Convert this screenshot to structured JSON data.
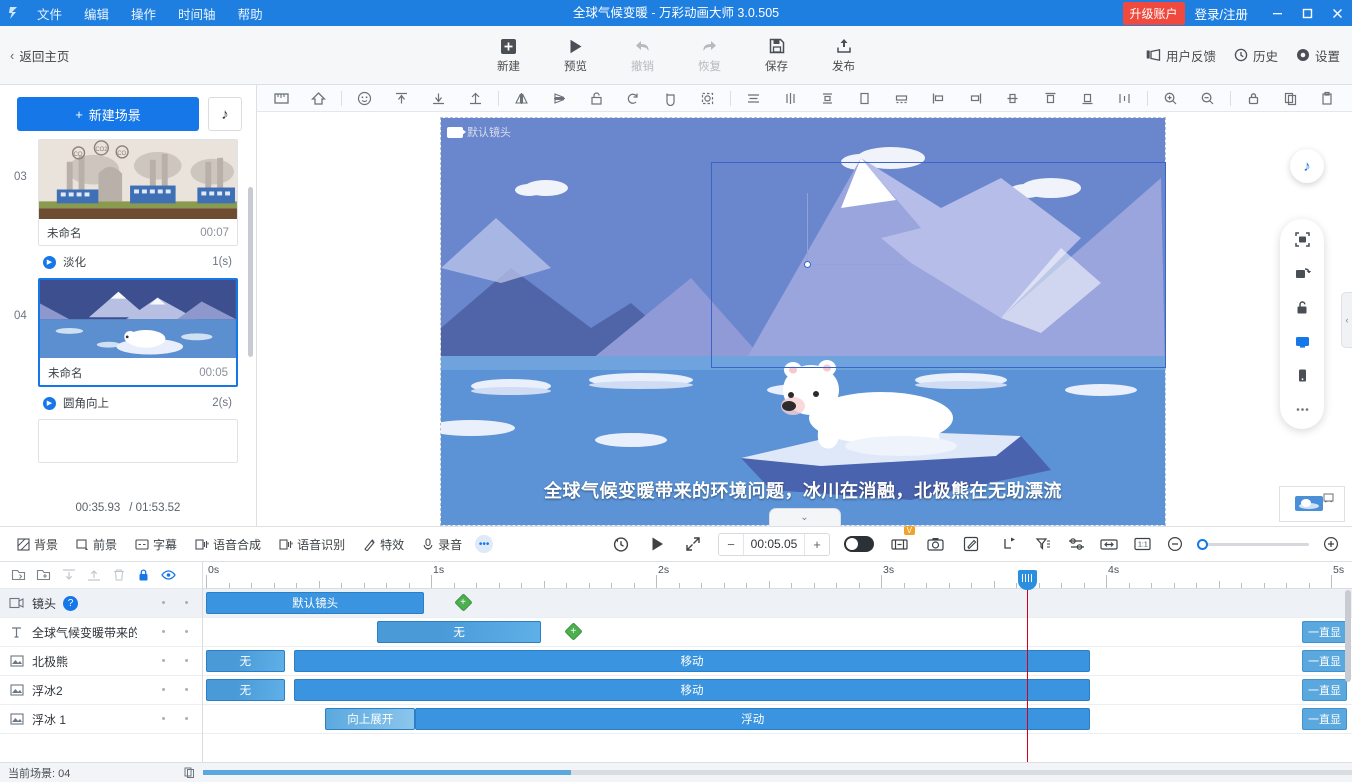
{
  "titlebar": {
    "logo_icon": "app-logo-icon",
    "menus": [
      "文件",
      "编辑",
      "操作",
      "时间轴",
      "帮助"
    ],
    "title": "全球气候变暖 - 万彩动画大师 3.0.505",
    "upgrade_label": "升级账户",
    "login_label": "登录/注册",
    "minimize_icon": "minimize-icon",
    "maximize_icon": "maximize-icon",
    "close_icon": "close-icon",
    "accent": "#1f7fe0",
    "upgrade_color": "#f0493e"
  },
  "toptoolbar": {
    "back_label": "返回主页",
    "buttons": [
      {
        "label": "新建",
        "icon": "new-icon",
        "disabled": false
      },
      {
        "label": "预览",
        "icon": "play-icon",
        "disabled": false
      },
      {
        "label": "撤销",
        "icon": "undo-icon",
        "disabled": true
      },
      {
        "label": "恢复",
        "icon": "redo-icon",
        "disabled": true
      },
      {
        "label": "保存",
        "icon": "save-icon",
        "disabled": false
      },
      {
        "label": "发布",
        "icon": "publish-icon",
        "disabled": false
      }
    ],
    "right": [
      {
        "label": "用户反馈",
        "icon": "feedback-icon"
      },
      {
        "label": "历史",
        "icon": "history-icon"
      },
      {
        "label": "设置",
        "icon": "gear-icon"
      }
    ]
  },
  "scenepanel": {
    "new_scene_label": "新建场景",
    "music_icon": "music-note-icon",
    "scenes": [
      {
        "number": "03",
        "name": "未命名",
        "duration": "00:07",
        "selected": false,
        "art": "factory"
      },
      {
        "number": "04",
        "name": "未命名",
        "duration": "00:05",
        "selected": true,
        "art": "polarbear"
      }
    ],
    "transitions": [
      {
        "name": "淡化",
        "duration": "1(s)"
      },
      {
        "name": "圆角向上",
        "duration": "2(s)"
      }
    ],
    "footer_current": "00:35.93",
    "footer_total": "/ 01:53.52"
  },
  "canvas": {
    "camera_label": "默认镜头",
    "subtitle": "全球气候变暖带来的环境问题，冰川在消融，北极熊在无助漂流",
    "toolbar_icons": [
      "ruler-icon",
      "home-icon",
      "smiley-icon",
      "align-top-icon",
      "align-bottom-icon",
      "align-up-icon",
      "flip-horizontal-icon",
      "flip-vertical-icon",
      "lock-shape-icon",
      "rotate-left-icon",
      "rotate-right-icon",
      "group-icon",
      "align-left-text-icon",
      "align-center-vertical-icon",
      "align-distribute-icon",
      "crop-icon",
      "align-justify-icon",
      "align-left-icon",
      "align-right-icon",
      "align-middle-icon",
      "align-top2-icon",
      "align-bottom2-icon",
      "distribute-h-icon",
      "zoom-in-icon",
      "zoom-out-icon",
      "lock-icon",
      "copy-icon",
      "paste-icon"
    ],
    "float_icons": [
      "fit-screen-icon",
      "crop-rotate-icon",
      "unlock-icon",
      "screen-icon",
      "mobile-icon",
      "more-icon"
    ],
    "music_fab_icon": "music-note-icon",
    "collapse_icon": "chevron-down-icon",
    "right_tab_icon": "chevron-left-icon",
    "preview_thumb_icon": "preview-thumbnail-icon"
  },
  "playbar": {
    "left_items": [
      {
        "label": "背景",
        "icon": "background-icon"
      },
      {
        "label": "前景",
        "icon": "foreground-icon"
      },
      {
        "label": "字幕",
        "icon": "subtitle-icon"
      },
      {
        "label": "语音合成",
        "icon": "tts-icon"
      },
      {
        "label": "语音识别",
        "icon": "asr-icon"
      },
      {
        "label": "特效",
        "icon": "effects-icon"
      },
      {
        "label": "录音",
        "icon": "microphone-icon"
      }
    ],
    "more_icon": "more-dots-icon",
    "replay_icon": "replay-icon",
    "play_icon": "play-icon",
    "fullscreen_icon": "expand-icon",
    "minus_label": "−",
    "time_value": "00:05.05",
    "plus_label": "+",
    "toggle_state": "off",
    "vip_badge": "V",
    "right_icons": [
      "ratio-icon",
      "camera-icon",
      "edit-icon",
      "cut-icon",
      "filter-icon",
      "settings-sliders-icon",
      "split-icon",
      "one-to-one-icon"
    ],
    "zoom_out_icon": "zoom-out-icon",
    "zoom_in_icon": "zoom-in-icon",
    "zoom_value": 0
  },
  "timeline": {
    "tools": [
      "import-icon",
      "add-folder-icon",
      "move-down-icon",
      "move-up-icon",
      "delete-icon",
      "lock-icon",
      "eye-icon"
    ],
    "ruler": {
      "labels": [
        "0s",
        "1s",
        "2s",
        "3s",
        "4s",
        "5s"
      ],
      "max_seconds": 5
    },
    "playhead_time": "3.65",
    "tracks": [
      {
        "name": "镜头",
        "icon": "camera-track-icon",
        "selected": true,
        "has_help": true,
        "clips": [
          {
            "label": "默认镜头",
            "start": 0.0,
            "end": 0.97,
            "style": "solid"
          }
        ],
        "keyframes": [
          1.14
        ],
        "always_label": null
      },
      {
        "name": "全球气候变暖带来的",
        "icon": "text-track-icon",
        "selected": false,
        "has_help": false,
        "clips": [
          {
            "label": "无",
            "start": 0.76,
            "end": 1.49,
            "style": "grad"
          }
        ],
        "keyframes": [
          1.63
        ],
        "always_label": "一直显"
      },
      {
        "name": "北极熊",
        "icon": "image-track-icon",
        "selected": false,
        "has_help": false,
        "clips": [
          {
            "label": "无",
            "start": 0.0,
            "end": 0.35,
            "style": "grad"
          },
          {
            "label": "移动",
            "start": 0.39,
            "end": 3.93,
            "style": "solid"
          }
        ],
        "keyframes": [],
        "always_label": "一直显"
      },
      {
        "name": "浮冰2",
        "icon": "image-track-icon",
        "selected": false,
        "has_help": false,
        "clips": [
          {
            "label": "无",
            "start": 0.0,
            "end": 0.35,
            "style": "grad"
          },
          {
            "label": "移动",
            "start": 0.39,
            "end": 3.93,
            "style": "solid"
          }
        ],
        "keyframes": [],
        "always_label": "一直显"
      },
      {
        "name": "浮冰 1",
        "icon": "image-track-icon",
        "selected": false,
        "has_help": false,
        "clips": [
          {
            "label": "向上展开",
            "start": 0.53,
            "end": 0.93,
            "style": "gradlight"
          },
          {
            "label": "浮动",
            "start": 0.93,
            "end": 3.93,
            "style": "solid"
          }
        ],
        "keyframes": [],
        "always_label": "一直显"
      }
    ]
  },
  "statusbar": {
    "current_scene_label": "当前场景: 04",
    "copy_icon": "copy-icon"
  }
}
